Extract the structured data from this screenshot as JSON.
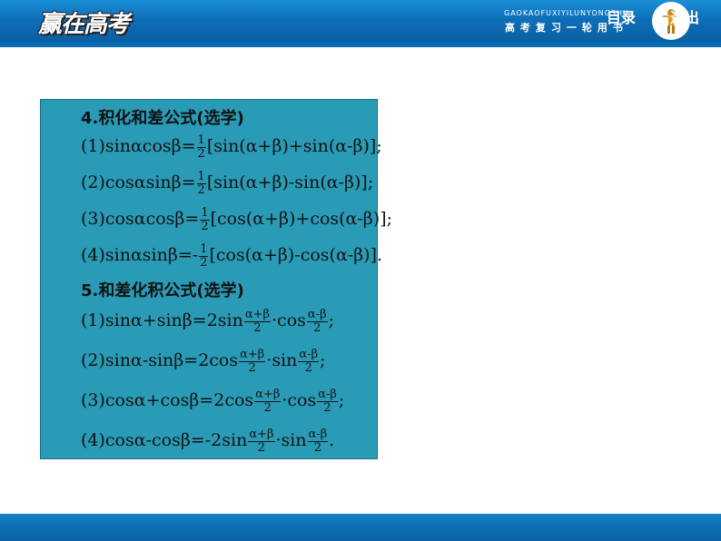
{
  "header": {
    "logo_text": "赢在高考",
    "pinyin": "GAOKAOFUXIYILUNYONGSHU",
    "subtitle": "高考复习一轮用书"
  },
  "content": {
    "heading4": "4.积化和差公式(选学)",
    "l1": {
      "pre": "(1)sinαcosβ=",
      "num": "1",
      "den": "2",
      "post": "[sin(α+β)+sin(α-β)];"
    },
    "l2": {
      "pre": "(2)cosαsinβ=",
      "num": "1",
      "den": "2",
      "post": "[sin(α+β)-sin(α-β)];"
    },
    "l3": {
      "pre": "(3)cosαcosβ=",
      "num": "1",
      "den": "2",
      "post": "[cos(α+β)+cos(α-β)];"
    },
    "l4": {
      "pre": "(4)sinαsinβ=-",
      "num": "1",
      "den": "2",
      "post": "[cos(α+β)-cos(α-β)]."
    },
    "heading5": "5.和差化积公式(选学)",
    "m1": {
      "pre": "(1)sinα+sinβ=2sin",
      "n1": "α+β",
      "d1": "2",
      "mid": "·cos",
      "n2": "α-β",
      "d2": "2",
      "end": ";"
    },
    "m2": {
      "pre": "(2)sinα-sinβ=2cos",
      "n1": "α+β",
      "d1": "2",
      "mid": "·sin",
      "n2": "α-β",
      "d2": "2",
      "end": ";"
    },
    "m3": {
      "pre": "(3)cosα+cosβ=2cos",
      "n1": "α+β",
      "d1": "2",
      "mid": "·cos",
      "n2": "α-β",
      "d2": "2",
      "end": ";"
    },
    "m4": {
      "pre": "(4)cosα-cosβ=-2sin",
      "n1": "α+β",
      "d1": "2",
      "mid": "·sin",
      "n2": "α-β",
      "d2": "2",
      "end": "."
    }
  },
  "footer": {
    "toc_label": "目录",
    "exit_label": "退出"
  },
  "colors": {
    "header_blue": "#0d6fb8",
    "box_teal": "#2a9bb6"
  }
}
